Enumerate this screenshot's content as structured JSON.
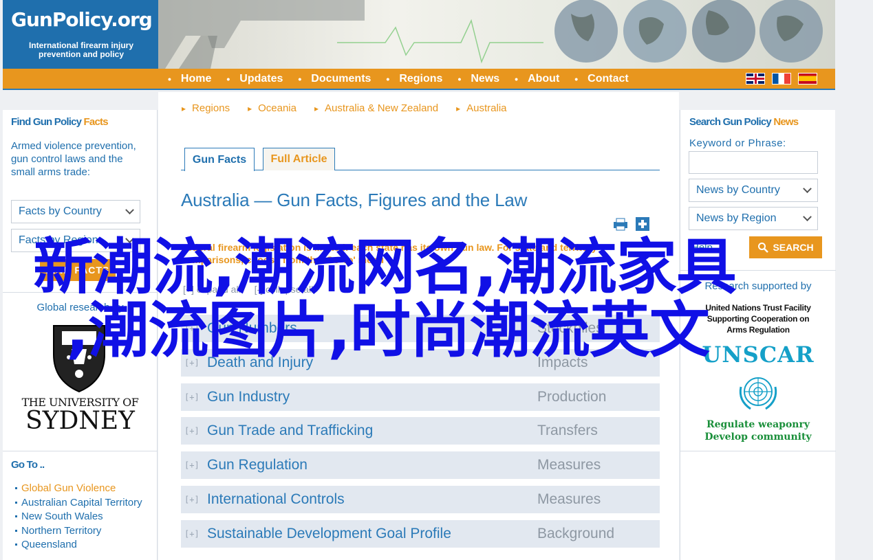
{
  "site": {
    "logo_name": "GunPolicy.org",
    "logo_tagline": "International firearm injury prevention and policy"
  },
  "nav": {
    "items": [
      "Home",
      "Updates",
      "Documents",
      "Regions",
      "News",
      "About",
      "Contact"
    ],
    "flags": [
      "uk-flag-icon",
      "france-flag-icon",
      "spain-flag-icon"
    ]
  },
  "left": {
    "title_a": "Find Gun Policy ",
    "title_b": "Facts",
    "description": "Armed violence prevention, gun control laws and the small arms trade:",
    "select_country": "Facts by Country",
    "select_region": "Facts by Region",
    "find_button": "FIND FACTS",
    "research_label": "Global research by",
    "university_line1": "THE UNIVERSITY OF",
    "university_line2": "SYDNEY",
    "goto_title": "Go To ..",
    "goto_items": [
      "Global Gun Violence",
      "Australian Capital Territory",
      "New South Wales",
      "Northern Territory",
      "Queensland"
    ]
  },
  "main": {
    "breadcrumb": [
      "Regions",
      "Oceania",
      "Australia & New Zealand",
      "Australia"
    ],
    "tab_facts": "Gun Facts",
    "tab_article": "Full Article",
    "page_title": "Australia — Gun Facts, Figures and the Law",
    "notice": "Federal firearm legislation is limited: each state has its own gun law. For state and territory comparisons, choose from the 'Go To' menu",
    "expand_all": "[+] expand all",
    "collapse_all": "[-] collapse all",
    "rows": [
      {
        "topic": "Gun Numbers",
        "sub": "Stockpiles"
      },
      {
        "topic": "Death and Injury",
        "sub": "Impacts"
      },
      {
        "topic": "Gun Industry",
        "sub": "Production"
      },
      {
        "topic": "Gun Trade and Trafficking",
        "sub": "Transfers"
      },
      {
        "topic": "Gun Regulation",
        "sub": "Measures"
      },
      {
        "topic": "International Controls",
        "sub": "Measures"
      },
      {
        "topic": "Sustainable Development Goal Profile",
        "sub": "Background"
      }
    ],
    "row_marker": "[+]"
  },
  "right": {
    "title_a": "Search Gun Policy ",
    "title_b": "News",
    "keyword_label": "Keyword or Phrase:",
    "select_country": "News by Country",
    "select_region": "News by Region",
    "help": "Help",
    "search_button": "SEARCH",
    "research_label": "Research supported by",
    "trust_lines": [
      "United Nations Trust Facility",
      "Supporting Cooperation on",
      "Arms Regulation"
    ],
    "unscar": "UNSCAR",
    "unscar_tag_1": "Regulate weaponry",
    "unscar_tag_2": "Develop community"
  },
  "overlay": {
    "line1": "新潮流,潮流网名,潮流家具",
    "line2": ",潮流图片,时尚潮流英文"
  },
  "colors": {
    "brand_blue": "#1f6fad",
    "accent_orange": "#e8961e",
    "row_bg": "#e2e8f0",
    "overlay_blue": "#1010e6"
  }
}
